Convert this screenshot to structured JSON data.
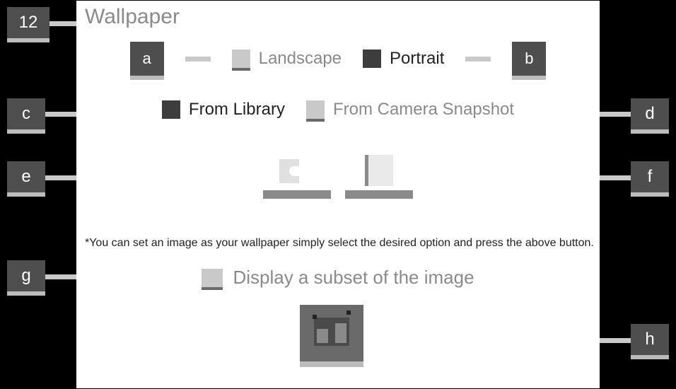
{
  "title": "Wallpaper",
  "callouts": {
    "topLeft": "12",
    "orientA": "a",
    "orientB": "b",
    "srcC": "c",
    "srcD": "d",
    "btnE": "e",
    "btnF": "f",
    "subsetG": "g",
    "cropH": "h"
  },
  "orientation": {
    "landscape": "Landscape",
    "portrait": "Portrait"
  },
  "source": {
    "library": "From Library",
    "camera": "From Camera Snapshot"
  },
  "note": "*You can set an image as your wallpaper simply select the desired option and press the above button.",
  "subset": "Display a subset of the image"
}
